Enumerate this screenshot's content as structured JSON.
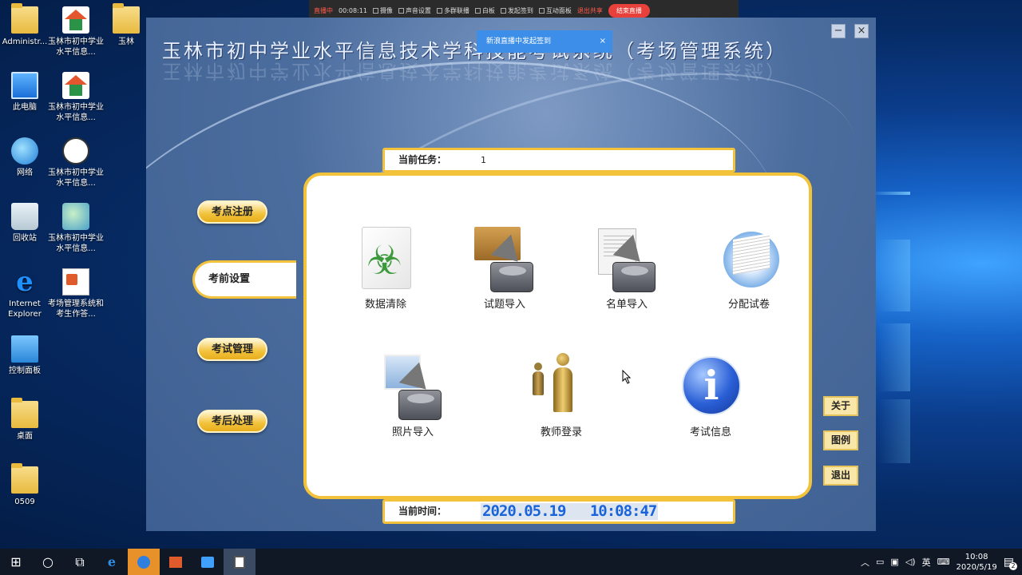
{
  "desktop": {
    "icons": [
      {
        "label": "Administr...",
        "type": "user"
      },
      {
        "label": "此电脑",
        "type": "pc"
      },
      {
        "label": "网络",
        "type": "network"
      },
      {
        "label": "回收站",
        "type": "recycle"
      },
      {
        "label": "Internet Explorer",
        "type": "ie"
      },
      {
        "label": "控制面板",
        "type": "control"
      },
      {
        "label": "桌面",
        "type": "folder"
      },
      {
        "label": "0509",
        "type": "folder"
      },
      {
        "label": "玉林市初中学业水平信息...",
        "type": "house"
      },
      {
        "label": "玉林市初中学业水平信息...",
        "type": "house"
      },
      {
        "label": "玉林市初中学业水平信息...",
        "type": "clock"
      },
      {
        "label": "玉林市初中学业水平信息...",
        "type": "globe"
      },
      {
        "label": "考场管理系统和考生作答...",
        "type": "doc"
      },
      {
        "label": "玉林",
        "type": "folder"
      }
    ]
  },
  "recording_bar": {
    "status": "直播中",
    "timer": "00:08:11",
    "items": [
      "摄像",
      "声音设置",
      "多群联播",
      "白板",
      "发起签到",
      "互动面板"
    ],
    "stop_share": "退出共享",
    "end_live": "结束直播"
  },
  "toast": {
    "text": "新浪直播中发起签到",
    "close": "×"
  },
  "app": {
    "title": "玉林市初中学业水平信息技术学科技能考试系统（考场管理系统）",
    "minimize": "−",
    "close": "×",
    "current_task_label": "当前任务：",
    "current_task_value": "1",
    "current_time_label": "当前时间：",
    "current_time_value": "2020.05.19 10:08:47",
    "side_buttons": {
      "register": "考点注册",
      "pre_exam": "考前设置",
      "exam_manage": "考试管理",
      "post_exam": "考后处理"
    },
    "tiles": {
      "data_clear": "数据清除",
      "question_import": "试题导入",
      "roster_import": "名单导入",
      "assign_paper": "分配试卷",
      "photo_import": "照片导入",
      "teacher_login": "教师登录",
      "exam_info": "考试信息"
    },
    "right_buttons": {
      "about": "关于",
      "legend": "图例",
      "exit": "退出"
    }
  },
  "taskbar": {
    "tray_ime": "英",
    "time": "10:08",
    "date": "2020/5/19",
    "notif_count": "2",
    "start_icon": "⊞",
    "search_icon": "○",
    "task_view_icon": "⧉"
  }
}
